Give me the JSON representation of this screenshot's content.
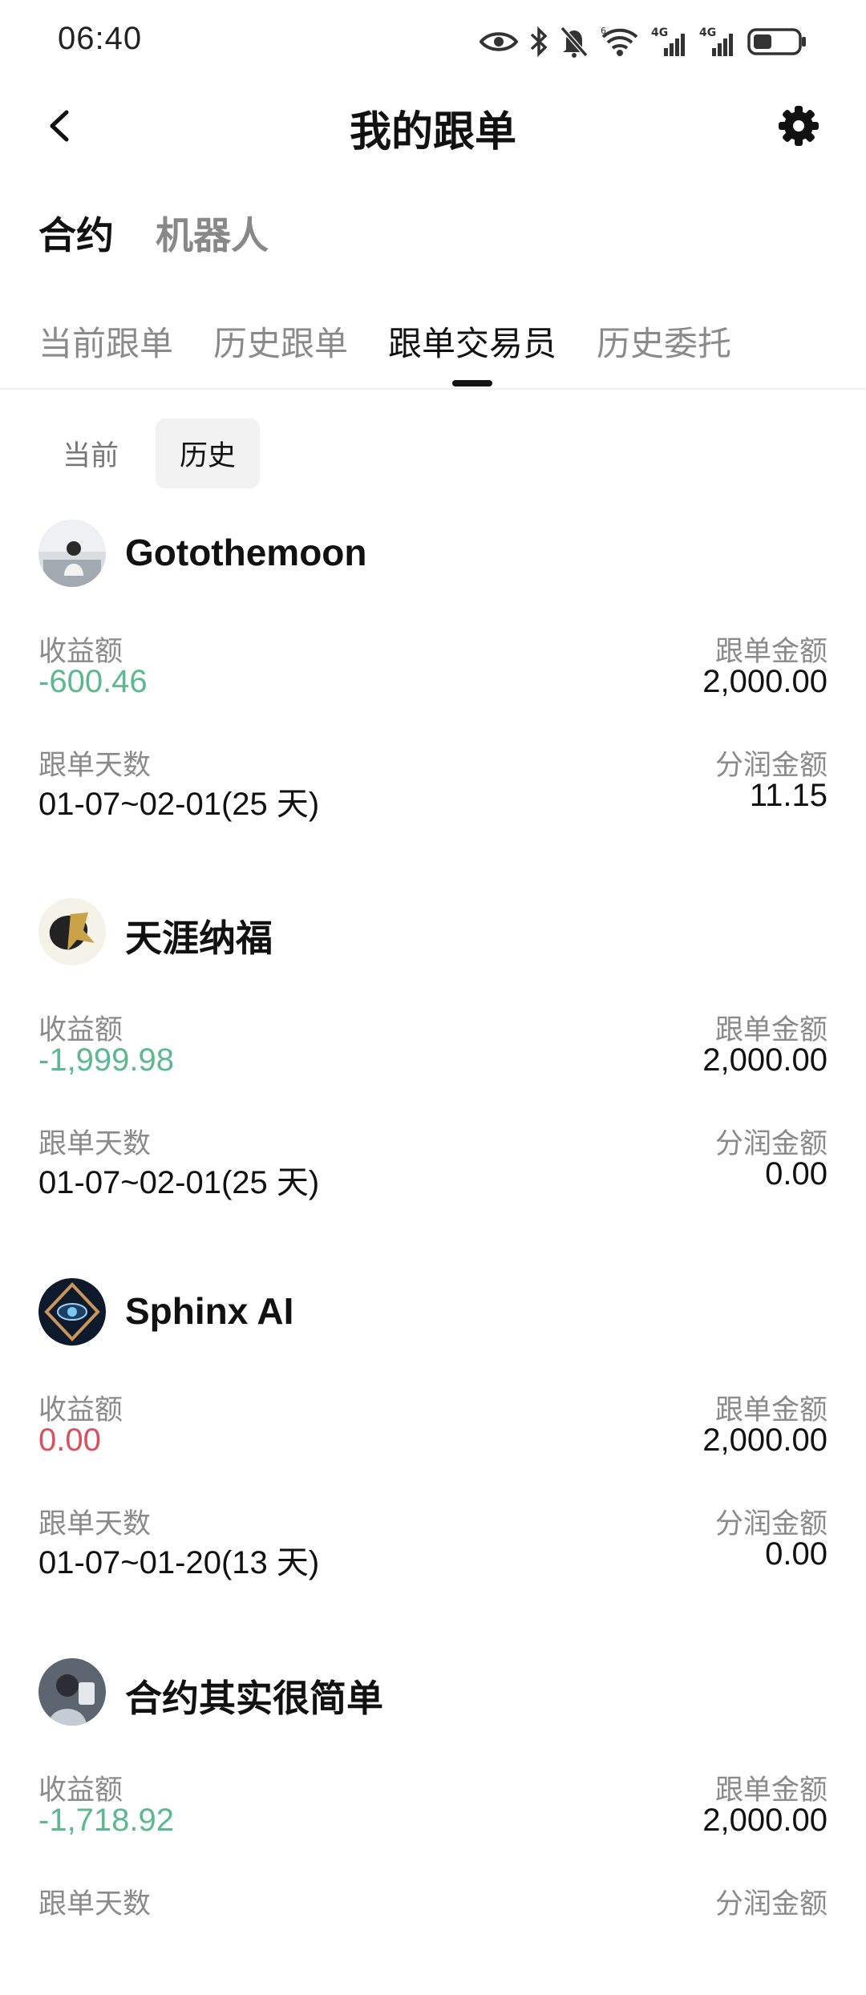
{
  "status_bar": {
    "time": "06:40",
    "icons": [
      "eye-icon",
      "bluetooth-icon",
      "bell-muted-icon",
      "wifi-icon",
      "signal-4g-icon",
      "signal-4g-icon",
      "battery-icon"
    ],
    "network_label": "4G"
  },
  "header": {
    "title": "我的跟单"
  },
  "main_tabs": [
    "合约",
    "机器人"
  ],
  "sub_tabs": [
    "当前跟单",
    "历史跟单",
    "跟单交易员",
    "历史委托"
  ],
  "segmented": [
    "当前",
    "历史"
  ],
  "labels": {
    "profit": "收益额",
    "amount": "跟单金额",
    "days": "跟单天数",
    "share": "分润金额"
  },
  "colors": {
    "negative": "#5bb88f",
    "zero": "#d9505e"
  },
  "traders": [
    {
      "name": "Gotothemoon",
      "profit": "-600.46",
      "amount": "2,000.00",
      "days": "01-07~02-01(25 天)",
      "share": "11.15"
    },
    {
      "name": "天涯纳福",
      "profit": "-1,999.98",
      "amount": "2,000.00",
      "days": "01-07~02-01(25 天)",
      "share": "0.00"
    },
    {
      "name": "Sphinx AI",
      "profit": "0.00",
      "amount": "2,000.00",
      "days": "01-07~01-20(13 天)",
      "share": "0.00"
    },
    {
      "name": "合约其实很简单",
      "profit": "-1,718.92",
      "amount": "2,000.00"
    }
  ]
}
